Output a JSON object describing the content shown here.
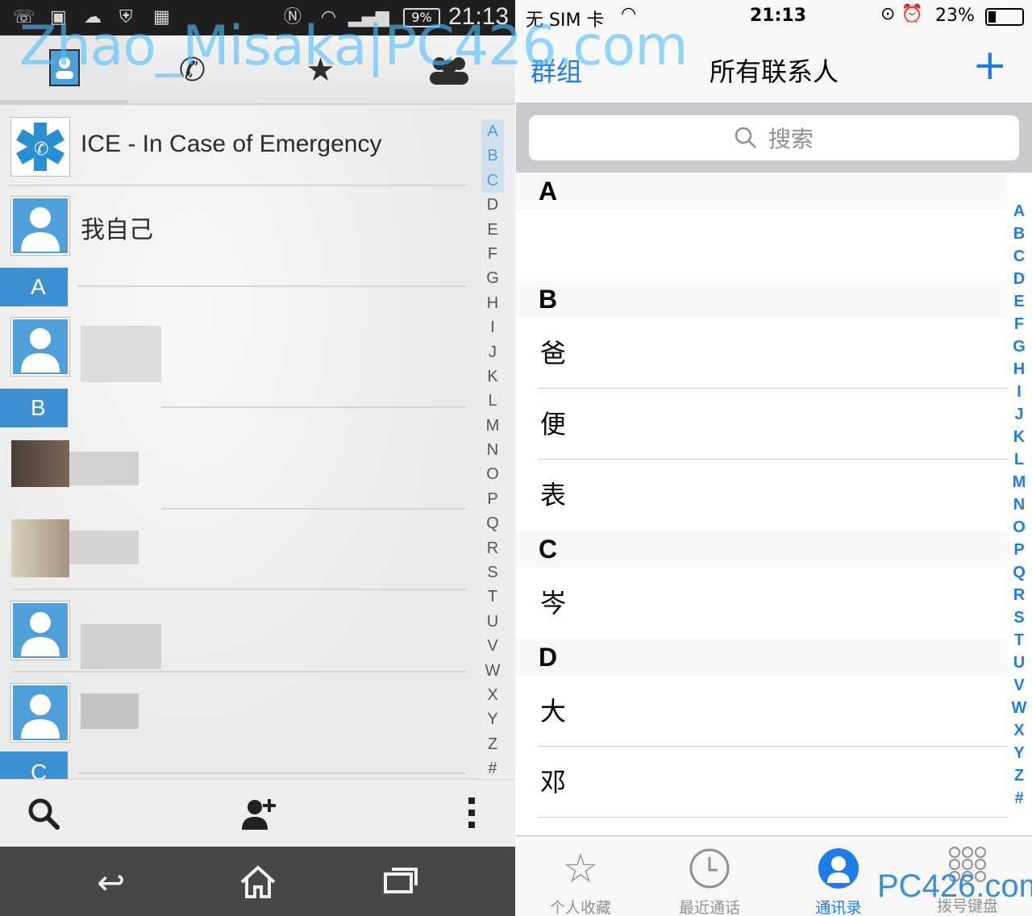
{
  "android": {
    "status": {
      "battery": "9%",
      "time": "21:13"
    },
    "ice_label": "ICE - In Case of Emergency",
    "me_label": "我自己",
    "sections": [
      "A",
      "B",
      "C"
    ],
    "index": [
      "A",
      "B",
      "C",
      "D",
      "E",
      "F",
      "G",
      "H",
      "I",
      "J",
      "K",
      "L",
      "M",
      "N",
      "O",
      "P",
      "Q",
      "R",
      "S",
      "T",
      "U",
      "V",
      "W",
      "X",
      "Y",
      "Z",
      "#"
    ]
  },
  "watermark": "Zhao_Misaka|PC426.com",
  "ios": {
    "status": {
      "carrier": "无 SIM 卡",
      "time": "21:13",
      "battery": "23%"
    },
    "nav": {
      "left": "群组",
      "title": "所有联系人",
      "add": "+"
    },
    "search_placeholder": "搜索",
    "groups": [
      {
        "letter": "A",
        "names": []
      },
      {
        "letter": "B",
        "names": [
          "爸",
          "便",
          "表"
        ]
      },
      {
        "letter": "C",
        "names": [
          "岑"
        ]
      },
      {
        "letter": "D",
        "names": [
          "大",
          "邓"
        ]
      }
    ],
    "index": [
      "A",
      "B",
      "C",
      "D",
      "E",
      "F",
      "G",
      "H",
      "I",
      "J",
      "K",
      "L",
      "M",
      "N",
      "O",
      "P",
      "Q",
      "R",
      "S",
      "T",
      "U",
      "V",
      "W",
      "X",
      "Y",
      "Z",
      "#"
    ],
    "tabs": [
      {
        "label": "个人收藏",
        "icon": "star-icon"
      },
      {
        "label": "最近通话",
        "icon": "clock-icon"
      },
      {
        "label": "通讯录",
        "icon": "contacts-icon",
        "active": true
      },
      {
        "label": "拨号键盘",
        "icon": "keypad-icon"
      }
    ],
    "brand": "PC426.com"
  },
  "colors": {
    "android_accent": "#4f9fd8",
    "ios_accent": "#1f7ce6"
  }
}
